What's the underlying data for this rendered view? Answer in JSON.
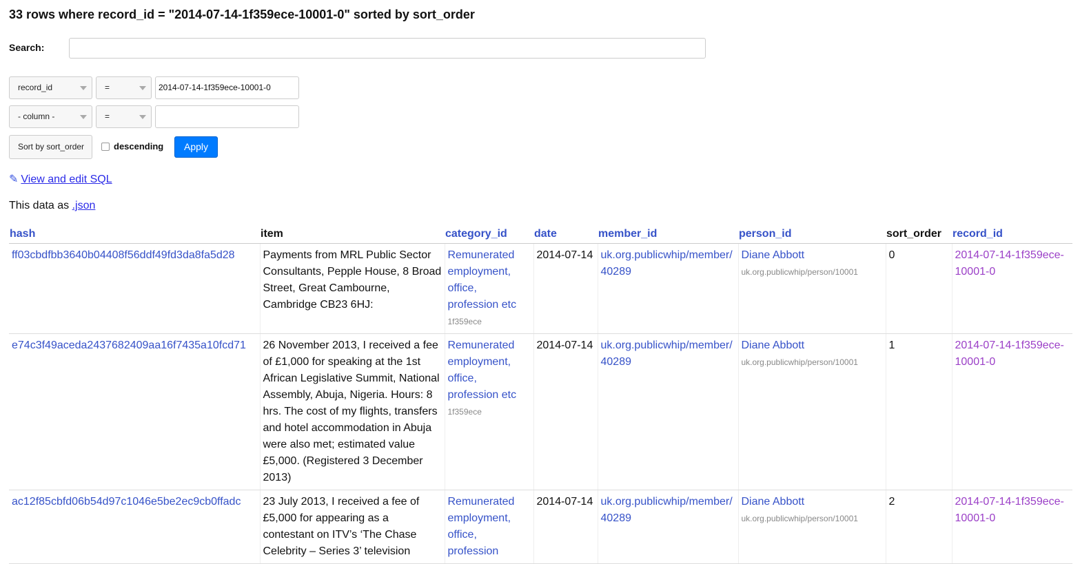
{
  "header": {
    "title": "33 rows where record_id = \"2014-07-14-1f359ece-10001-0\" sorted by sort_order"
  },
  "search": {
    "label": "Search:",
    "value": ""
  },
  "filters": [
    {
      "column": "record_id",
      "op": "=",
      "value": "2014-07-14-1f359ece-10001-0"
    },
    {
      "column": "- column -",
      "op": "=",
      "value": ""
    }
  ],
  "sort": {
    "label": "Sort by sort_order",
    "descending_label": "descending",
    "descending_checked": false,
    "apply_label": "Apply"
  },
  "links": {
    "pencil": "✎",
    "view_sql": "View and edit SQL",
    "data_as": "This data as",
    "json": ".json"
  },
  "table": {
    "columns": [
      "hash",
      "item",
      "category_id",
      "date",
      "member_id",
      "person_id",
      "sort_order",
      "record_id"
    ],
    "rows": [
      {
        "hash": "ff03cbdfbb3640b04408f56ddf49fd3da8fa5d28",
        "item": "Payments from MRL Public Sector Consultants, Pepple House, 8 Broad Street, Great Cambourne, Cambridge CB23 6HJ:",
        "category": "Remunerated employment, office, profession etc",
        "category_sub": "1f359ece",
        "date": "2014-07-14",
        "member_id": "uk.org.publicwhip/member/40289",
        "person_name": "Diane Abbott",
        "person_sub": "uk.org.publicwhip/person/10001",
        "sort_order": "0",
        "record_id": "2014-07-14-1f359ece-10001-0"
      },
      {
        "hash": "e74c3f49aceda2437682409aa16f7435a10fcd71",
        "item": "26 November 2013, I received a fee of £1,000 for speaking at the 1st African Legislative Summit, National Assembly, Abuja, Nigeria. Hours: 8 hrs. The cost of my flights, transfers and hotel accommodation in Abuja were also met; estimated value £5,000. (Registered 3 December 2013)",
        "category": "Remunerated employment, office, profession etc",
        "category_sub": "1f359ece",
        "date": "2014-07-14",
        "member_id": "uk.org.publicwhip/member/40289",
        "person_name": "Diane Abbott",
        "person_sub": "uk.org.publicwhip/person/10001",
        "sort_order": "1",
        "record_id": "2014-07-14-1f359ece-10001-0"
      },
      {
        "hash": "ac12f85cbfd06b54d97c1046e5be2ec9cb0ffadc",
        "item": "23 July 2013, I received a fee of £5,000 for appearing as a contestant on ITV’s ‘The Chase Celebrity – Series 3’ television",
        "category": "Remunerated employment, office, profession",
        "category_sub": "",
        "date": "2014-07-14",
        "member_id": "uk.org.publicwhip/member/40289",
        "person_name": "Diane Abbott",
        "person_sub": "uk.org.publicwhip/person/10001",
        "sort_order": "2",
        "record_id": "2014-07-14-1f359ece-10001-0"
      }
    ]
  }
}
